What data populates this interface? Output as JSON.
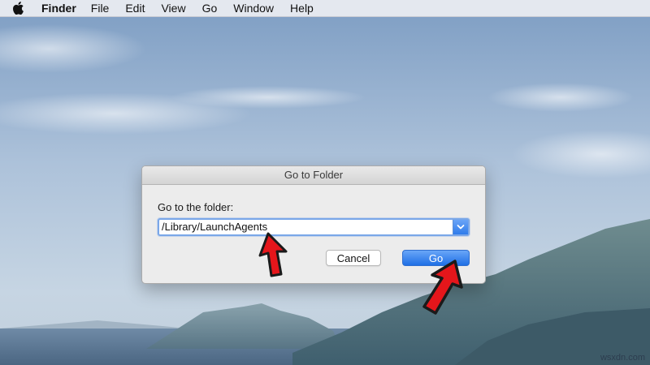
{
  "menubar": {
    "apple_icon": "apple-logo-icon",
    "app_name": "Finder",
    "items": [
      {
        "label": "File"
      },
      {
        "label": "Edit"
      },
      {
        "label": "View"
      },
      {
        "label": "Go"
      },
      {
        "label": "Window"
      },
      {
        "label": "Help"
      }
    ]
  },
  "dialog": {
    "title": "Go to Folder",
    "prompt": "Go to the folder:",
    "path_value": "/Library/LaunchAgents",
    "dropdown_icon": "chevron-down-icon",
    "cancel_label": "Cancel",
    "go_label": "Go"
  },
  "annotations": {
    "arrow_color": "#e5161b",
    "arrows": [
      {
        "points_to": "path-input"
      },
      {
        "points_to": "go-button"
      }
    ]
  },
  "watermark": "wsxdn.com",
  "colors": {
    "accent": "#2f7bea",
    "dialog_bg": "#ececec",
    "focus_ring": "#7aa7e8"
  }
}
